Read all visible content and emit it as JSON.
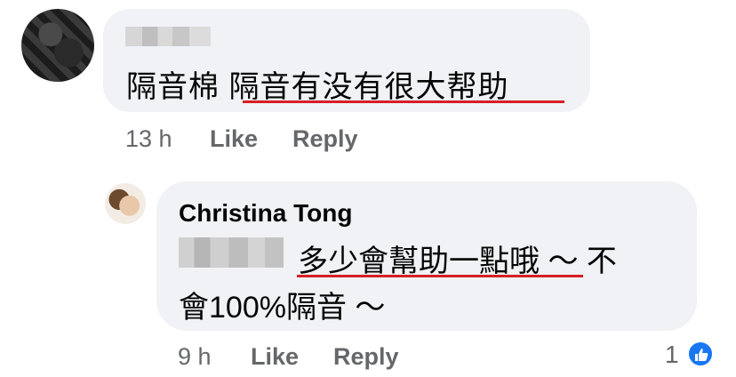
{
  "comments": [
    {
      "author": "",
      "text_plain": "隔音棉 ",
      "text_underlined": "隔音有没有很大帮助",
      "time": "13 h",
      "like_label": "Like",
      "reply_label": "Reply"
    },
    {
      "author": "Christina Tong",
      "text_underlined": "多少會幫助一點哦",
      "text_rest": " ～ 不",
      "text_line2": "會100%隔音 ～",
      "time": "9 h",
      "like_label": "Like",
      "reply_label": "Reply",
      "reaction_count": "1",
      "reaction_icon": "thumbs-up-icon"
    }
  ],
  "colors": {
    "bubble": "#f0f2f5",
    "underline": "#d61f26",
    "meta": "#65676b",
    "like_blue": "#1877f2"
  }
}
